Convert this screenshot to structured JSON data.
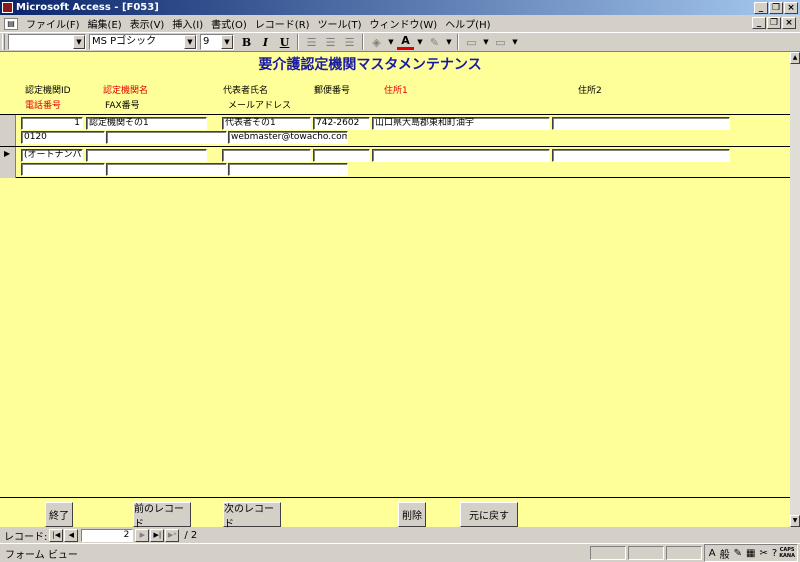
{
  "window": {
    "title": "Microsoft Access - [F053]"
  },
  "menu": {
    "items": [
      "ファイル(F)",
      "編集(E)",
      "表示(V)",
      "挿入(I)",
      "書式(O)",
      "レコード(R)",
      "ツール(T)",
      "ウィンドウ(W)",
      "ヘルプ(H)"
    ]
  },
  "toolbar": {
    "object_combo": "",
    "font_name": "MS Pゴシック",
    "font_size": "9",
    "bold": "B",
    "italic": "I",
    "underline": "U"
  },
  "form": {
    "title": "要介護認定機関マスタメンテナンス",
    "labels": {
      "id": "認定機関ID",
      "name": "認定機関名",
      "rep": "代表者氏名",
      "zip": "郵便番号",
      "addr1": "住所1",
      "addr2": "住所2",
      "tel": "電話番号",
      "fax": "FAX番号",
      "mail": "メールアドレス"
    },
    "records": [
      {
        "id": "1",
        "name": "認定機関その1",
        "rep": "代表者その1",
        "zip": "742-2602",
        "addr1": "山口県大島郡東和町油宇",
        "addr2": "",
        "tel": "0120",
        "fax": "",
        "mail": "webmaster@towacho.com"
      },
      {
        "id": "(オートナンバー)",
        "name": "",
        "rep": "",
        "zip": "",
        "addr1": "",
        "addr2": "",
        "tel": "",
        "fax": "",
        "mail": ""
      }
    ],
    "buttons": {
      "close": "終了",
      "prev": "前のレコード",
      "next": "次のレコード",
      "delete": "削除",
      "undo": "元に戻す"
    }
  },
  "nav": {
    "label": "レコード:",
    "current": "2",
    "total": "/ 2"
  },
  "status": {
    "text": "フォーム ビュー",
    "ime": "般",
    "caps_top": "CAPS",
    "caps_bottom": "KANA"
  }
}
